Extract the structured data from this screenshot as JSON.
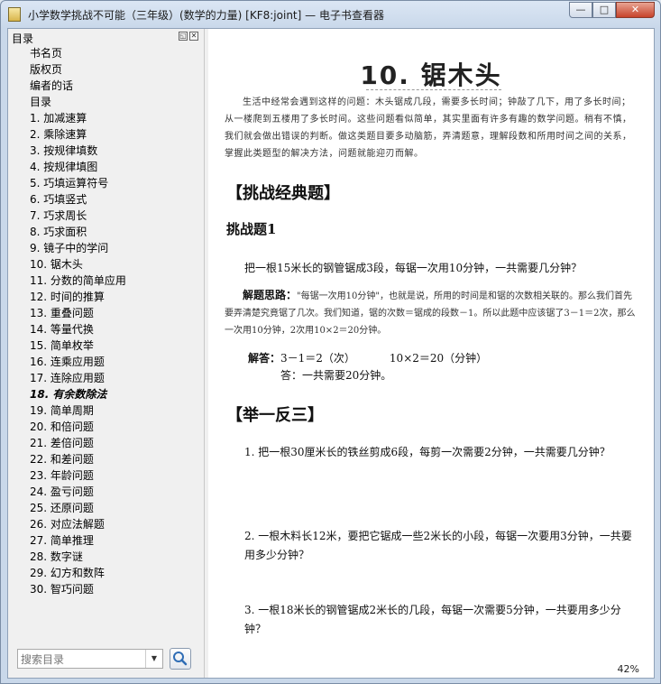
{
  "window": {
    "title": "小学数学挑战不可能（三年级）(数学的力量) [KF8:joint] — 电子书查看器",
    "minimize_label": "—",
    "maximize_label": "□",
    "close_label": "✕"
  },
  "sidebar": {
    "header": "目录",
    "items": [
      {
        "label": "书名页",
        "active": false
      },
      {
        "label": "版权页",
        "active": false
      },
      {
        "label": "编者的话",
        "active": false
      },
      {
        "label": "目录",
        "active": false
      },
      {
        "label": "1. 加减速算",
        "active": false
      },
      {
        "label": "2. 乘除速算",
        "active": false
      },
      {
        "label": "3. 按规律填数",
        "active": false
      },
      {
        "label": "4. 按规律填图",
        "active": false
      },
      {
        "label": "5. 巧填运算符号",
        "active": false
      },
      {
        "label": "6. 巧填竖式",
        "active": false
      },
      {
        "label": "7. 巧求周长",
        "active": false
      },
      {
        "label": "8. 巧求面积",
        "active": false
      },
      {
        "label": "9. 镜子中的学问",
        "active": false
      },
      {
        "label": "10. 锯木头",
        "active": false
      },
      {
        "label": "11. 分数的简单应用",
        "active": false
      },
      {
        "label": "12. 时间的推算",
        "active": false
      },
      {
        "label": "13. 重叠问题",
        "active": false
      },
      {
        "label": "14. 等量代换",
        "active": false
      },
      {
        "label": "15. 简单枚举",
        "active": false
      },
      {
        "label": "16. 连乘应用题",
        "active": false
      },
      {
        "label": "17. 连除应用题",
        "active": false
      },
      {
        "label": "18. 有余数除法",
        "active": true
      },
      {
        "label": "19. 简单周期",
        "active": false
      },
      {
        "label": "20. 和倍问题",
        "active": false
      },
      {
        "label": "21. 差倍问题",
        "active": false
      },
      {
        "label": "22. 和差问题",
        "active": false
      },
      {
        "label": "23. 年龄问题",
        "active": false
      },
      {
        "label": "24. 盈亏问题",
        "active": false
      },
      {
        "label": "25. 还原问题",
        "active": false
      },
      {
        "label": "26. 对应法解题",
        "active": false
      },
      {
        "label": "27. 简单推理",
        "active": false
      },
      {
        "label": "28. 数字谜",
        "active": false
      },
      {
        "label": "29. 幻方和数阵",
        "active": false
      },
      {
        "label": "30. 智巧问题",
        "active": false
      }
    ],
    "search_placeholder": "搜索目录"
  },
  "content": {
    "chapter_title": "10. 锯木头",
    "intro": "生活中经常会遇到这样的问题：木头锯成几段，需要多长时间；钟敲了几下，用了多长时间；从一楼爬到五楼用了多长时间。这些问题看似简单，其实里面有许多有趣的数学问题。稍有不慎，我们就会做出错误的判断。做这类题目要多动脑筋，弄清题意，理解段数和所用时间之间的关系，掌握此类题型的解决方法，问题就能迎刃而解。",
    "section1": "【挑战经典题】",
    "challenge_title": "挑战题1",
    "challenge_problem": "把一根15米长的钢管锯成3段，每锯一次用10分钟，一共需要几分钟？",
    "analysis_label": "解题思路：",
    "analysis_text": "\"每锯一次用10分钟\"，也就是说，所用的时间是和锯的次数相关联的。那么我们首先要弄清楚究竟锯了几次。我们知道，锯的次数＝锯成的段数－1。所以此题中应该锯了3－1＝2次，那么一次用10分钟，2次用10×2＝20分钟。",
    "answer_label": "解答：",
    "answer_line1a": "3－1＝2（次）",
    "answer_line1b": "10×2＝20（分钟）",
    "answer_line2": "答：一共需要20分钟。",
    "section2": "【举一反三】",
    "exercises": [
      "1. 把一根30厘米长的铁丝剪成6段，每剪一次需要2分钟，一共需要几分钟？",
      "2. 一根木料长12米，要把它锯成一些2米长的小段，每锯一次要用3分钟，一共要用多少分钟？",
      "3. 一根18米长的钢管锯成2米长的几段，每锯一次需要5分钟，一共要用多少分钟？"
    ],
    "zoom": "42%"
  }
}
